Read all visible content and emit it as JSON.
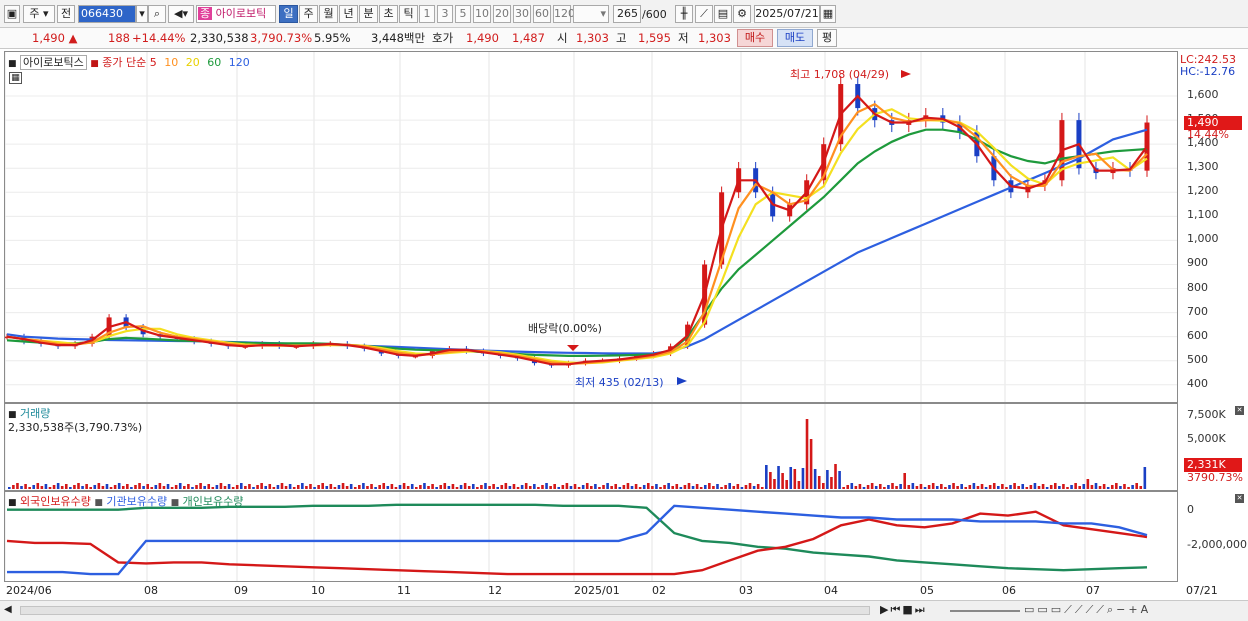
{
  "toolbar": {
    "market": "주",
    "prev_label": "전",
    "code": "066430",
    "stock_name": "아이로보틱",
    "stock_badge": "종",
    "periods": [
      "일",
      "주",
      "월",
      "년",
      "분",
      "초",
      "틱"
    ],
    "active_period": "일",
    "intervals": [
      "1",
      "3",
      "5",
      "10",
      "20",
      "30",
      "60",
      "120"
    ],
    "count_value": "265",
    "count_total": "/600",
    "date": "2025/07/21"
  },
  "infobar": {
    "price": "1,490",
    "change": "188",
    "change_pct": "+14.44%",
    "volume": "2,330,538",
    "volume_pct": "3,790.73%",
    "turnover": "5.95%",
    "amount": "3,448백만",
    "quote_label": "호가",
    "ask": "1,490",
    "bid": "1,487",
    "open_label": "시",
    "open": "1,303",
    "high_label": "고",
    "high": "1,595",
    "low_label": "저",
    "low": "1,303",
    "buy_label": "매수",
    "sell_label": "매도",
    "eval_label": "평"
  },
  "price_pane": {
    "legend_name": "아이로보틱스",
    "legend_ma_prefix": "종가 단순",
    "ma_labels": [
      "5",
      "10",
      "20",
      "60",
      "120"
    ],
    "lc": "LC:242.53",
    "hc": "HC:-12.76",
    "high_annot": "최고 1,708 (04/29)",
    "low_annot": "최저 435 (02/13)",
    "dividend_annot": "배당락(0.00%)",
    "price_box": "1,490",
    "pct_box": "14.44%"
  },
  "volume_pane": {
    "title": "거래량",
    "value": "2,330,538주(3,790.73%)",
    "box_value": "2,331K",
    "box_pct": "3790.73%"
  },
  "holding_pane": {
    "legend": [
      "외국인보유수량",
      "기관보유수량",
      "개인보유수량"
    ]
  },
  "chart_data": {
    "type": "line",
    "price_axis": {
      "ticks": [
        "1,600",
        "1,500",
        "1,400",
        "1,300",
        "1,200",
        "1,100",
        "1,000",
        "900",
        "800",
        "700",
        "600",
        "500",
        "400"
      ],
      "ylim": [
        370,
        1700
      ]
    },
    "volume_axis": {
      "ticks": [
        "7,500K",
        "5,000K"
      ]
    },
    "holding_axis": {
      "ticks": [
        "0",
        "-2,000,000"
      ]
    },
    "x_ticks": [
      "2024/06",
      "08",
      "09",
      "10",
      "11",
      "12",
      "2025/01",
      "02",
      "03",
      "04",
      "05",
      "06",
      "07",
      "07/21"
    ],
    "price_series": {
      "name": "종가",
      "values": [
        600,
        580,
        570,
        560,
        570,
        600,
        680,
        640,
        610,
        600,
        590,
        580,
        570,
        560,
        560,
        570,
        560,
        560,
        570,
        570,
        560,
        550,
        530,
        520,
        520,
        540,
        550,
        540,
        530,
        520,
        510,
        490,
        480,
        490,
        500,
        500,
        510,
        520,
        530,
        560,
        650,
        900,
        1200,
        1300,
        1200,
        1100,
        1150,
        1250,
        1400,
        1650,
        1550,
        1500,
        1480,
        1500,
        1520,
        1490,
        1450,
        1350,
        1250,
        1200,
        1230,
        1250,
        1500,
        1300,
        1280,
        1300,
        1290,
        1490
      ]
    },
    "series": [
      {
        "name": "5",
        "color": "#d41818"
      },
      {
        "name": "10",
        "color": "#ff9020"
      },
      {
        "name": "20",
        "color": "#f4e020"
      },
      {
        "name": "60",
        "color": "#1e9a3c"
      },
      {
        "name": "120",
        "color": "#2d5fe0"
      }
    ],
    "ma120": [
      610,
      600,
      596,
      592,
      590,
      588,
      586,
      585,
      584,
      583,
      582,
      581,
      580,
      578,
      576,
      574,
      572,
      570,
      568,
      566,
      564,
      562,
      560,
      557,
      554,
      551,
      548,
      545,
      542,
      540,
      538,
      536,
      534,
      533,
      532,
      531,
      530,
      530,
      531,
      540,
      560,
      590,
      630,
      670,
      710,
      750,
      790,
      830,
      870,
      910,
      950,
      980,
      1010,
      1040,
      1070,
      1100,
      1130,
      1160,
      1190,
      1220,
      1250,
      1280,
      1310,
      1340,
      1380,
      1420,
      1440,
      1460
    ],
    "ma60": [
      585,
      580,
      575,
      572,
      572,
      578,
      590,
      595,
      592,
      588,
      584,
      582,
      580,
      576,
      574,
      573,
      572,
      572,
      572,
      570,
      566,
      562,
      556,
      550,
      546,
      544,
      542,
      540,
      536,
      532,
      528,
      524,
      522,
      520,
      520,
      521,
      522,
      524,
      526,
      540,
      600,
      700,
      800,
      880,
      940,
      1000,
      1060,
      1120,
      1180,
      1250,
      1320,
      1370,
      1410,
      1440,
      1460,
      1460,
      1450,
      1420,
      1380,
      1350,
      1330,
      1320,
      1340,
      1350,
      1360,
      1370,
      1375,
      1380
    ],
    "foreign_holdings": [
      -1600000,
      -1700000,
      -1700000,
      -1750000,
      -2700000,
      -2750000,
      -2700000,
      -2700000,
      -2800000,
      -2850000,
      -2900000,
      -2950000,
      -3000000,
      -3050000,
      -3100000,
      -3150000,
      -3200000,
      -3250000,
      -3300000,
      -3300000,
      -3300000,
      -3300000,
      -3300000,
      -3300000,
      -3300000,
      -3100000,
      -2600000,
      -2100000,
      -1900000,
      -1500000,
      -800000,
      -500000,
      -800000,
      -900000,
      -700000,
      -200000,
      -300000,
      -100000,
      -800000,
      -1000000,
      -1200000,
      -1400000
    ],
    "institution_holdings": [
      -3200000,
      -3200000,
      -3200000,
      -3300000,
      -3300000,
      -1600000,
      -1600000,
      -1600000,
      -1600000,
      -1600000,
      -1600000,
      -1600000,
      -1600000,
      -1600000,
      -1600000,
      -1600000,
      -1600000,
      -1600000,
      -1600000,
      -1600000,
      -1600000,
      -1600000,
      -1600000,
      -1200000,
      200000,
      100000,
      0,
      -100000,
      -200000,
      -300000,
      -400000,
      -400000,
      -500000,
      -500000,
      -500000,
      -600000,
      -600000,
      -600000,
      -700000,
      -700000,
      -900000,
      -1300000
    ],
    "individual_holdings": [
      0,
      0,
      0,
      0,
      0,
      100000,
      100000,
      100000,
      150000,
      150000,
      150000,
      200000,
      200000,
      200000,
      250000,
      250000,
      250000,
      250000,
      250000,
      250000,
      200000,
      200000,
      200000,
      100000,
      -1200000,
      -1600000,
      -1700000,
      -1900000,
      -2000000,
      -2200000,
      -2300000,
      -2400000,
      -2600000,
      -2700000,
      -2800000,
      -2900000,
      -3000000,
      -3050000,
      -3100000,
      -3050000,
      -3000000,
      -2950000
    ]
  }
}
